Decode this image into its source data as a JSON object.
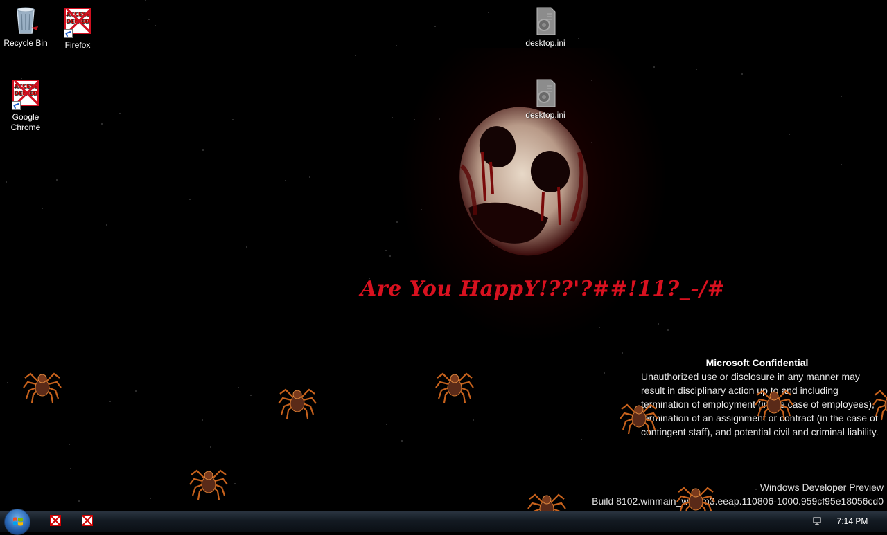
{
  "desktop": {
    "icons": [
      {
        "label": "Recycle Bin",
        "icon": "recycle-bin-icon"
      },
      {
        "label": "Firefox",
        "icon": "access-denied-icon"
      },
      {
        "label": "Google Chrome",
        "icon": "access-denied-icon"
      },
      {
        "label": "desktop.ini",
        "icon": "config-file-icon"
      },
      {
        "label": "desktop.ini",
        "icon": "config-file-icon"
      }
    ],
    "access_denied_text": [
      "ACCESS",
      "DENIED"
    ]
  },
  "wallpaper": {
    "slogan": "Are You HappY!??'?##!11?_-/#"
  },
  "notice": {
    "title": "Microsoft Confidential",
    "body": "Unauthorized use or disclosure in any manner may result in disciplinary action up to and including termination of employment (in the case of employees), termination of an assignment or contract (in the case of contingent staff), and potential civil and criminal liability."
  },
  "build": {
    "line1": "Windows Developer Preview",
    "line2": "Build 8102.winmain_win8m3.eeap.110806-1000.959cf95e18056cd0"
  },
  "taskbar": {
    "clock": "7:14 PM"
  },
  "colors": {
    "slogan": "#d8111f",
    "access_denied": "#d01020"
  }
}
